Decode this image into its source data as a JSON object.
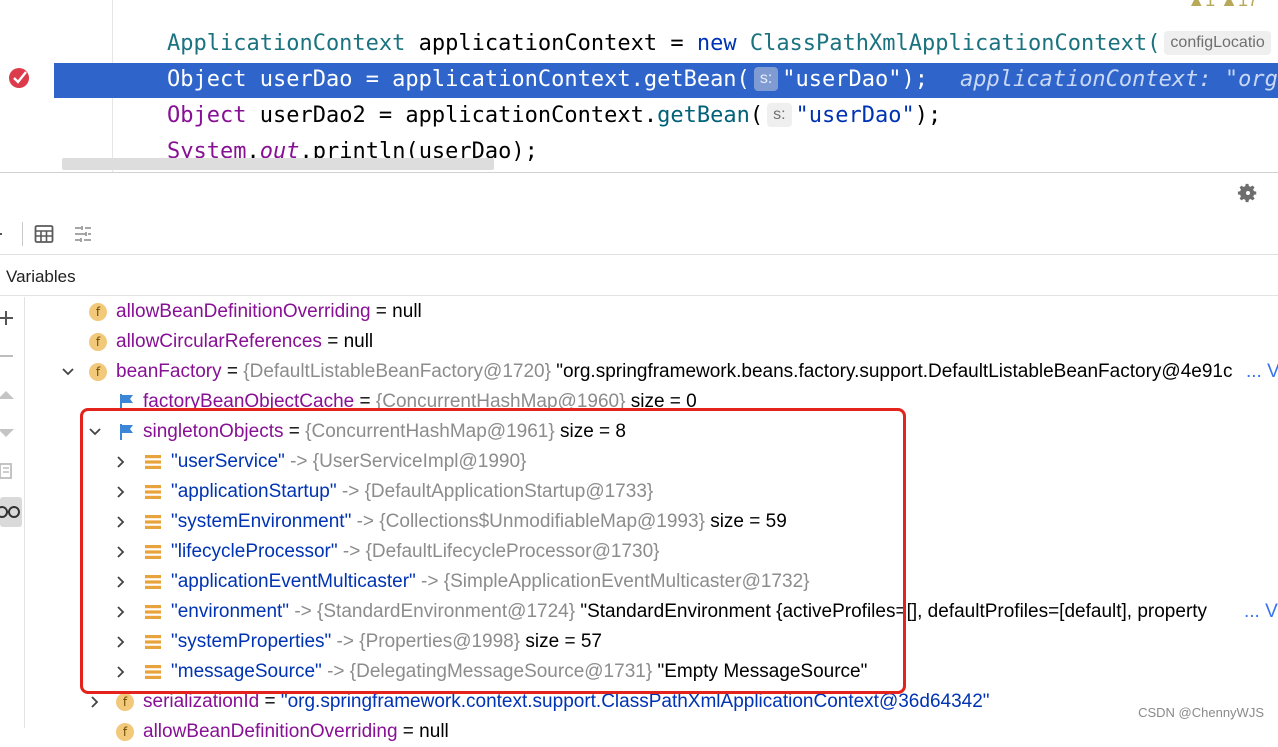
{
  "editor": {
    "line1": {
      "type": "ApplicationContext",
      "var": " applicationContext = ",
      "kw": "new",
      "cls": " ClassPathXmlApplicationContext(",
      "hint": "configLocatio"
    },
    "line2": {
      "type": "Object",
      "rest": " userDao = applicationContext.getBean(",
      "hint": "s:",
      "str": "\"userDao\"",
      "end": ");",
      "inline_hint": "applicationContext: \"org.s"
    },
    "line3": {
      "type": "Object",
      "rest": " userDao2 = applicationContext.",
      "method": "getBean",
      "paren": "(",
      "hint": "s:",
      "str": "\"userDao\"",
      "end": ");"
    },
    "line4": {
      "type": "System",
      "dot": ".",
      "field": "out",
      "rest": ".println(userDao);"
    },
    "warnings": "▲1  ▲17"
  },
  "debugger": {
    "variables_title": "Variables",
    "rows": [
      {
        "name": "allowBeanDefinitionOverriding",
        "value": " = null"
      },
      {
        "name": "allowCircularReferences",
        "value": " = null"
      },
      {
        "name": "beanFactory",
        "eq": " = ",
        "ref": "{DefaultListableBeanFactory@1720}",
        "value": " \"org.springframework.beans.factory.support.DefaultListableBeanFactory@4e91c",
        "more": "... V"
      },
      {
        "name": "factoryBeanObjectCache",
        "eq": " = ",
        "ref": "{ConcurrentHashMap@1960}",
        "value": "  size = 0"
      },
      {
        "name": "singletonObjects",
        "eq": " = ",
        "ref": "{ConcurrentHashMap@1961}",
        "value": "  size = 8"
      },
      {
        "key": "\"userService\"",
        "arrow": " -> ",
        "ref": "{UserServiceImpl@1990}",
        "value": ""
      },
      {
        "key": "\"applicationStartup\"",
        "arrow": " -> ",
        "ref": "{DefaultApplicationStartup@1733}",
        "value": ""
      },
      {
        "key": "\"systemEnvironment\"",
        "arrow": " -> ",
        "ref": "{Collections$UnmodifiableMap@1993}",
        "value": "  size = 59"
      },
      {
        "key": "\"lifecycleProcessor\"",
        "arrow": " -> ",
        "ref": "{DefaultLifecycleProcessor@1730}",
        "value": ""
      },
      {
        "key": "\"applicationEventMulticaster\"",
        "arrow": " -> ",
        "ref": "{SimpleApplicationEventMulticaster@1732}",
        "value": ""
      },
      {
        "key": "\"environment\"",
        "arrow": " -> ",
        "ref": "{StandardEnvironment@1724}",
        "value": " \"StandardEnvironment {activeProfiles=[], defaultProfiles=[default], property",
        "more": "... V"
      },
      {
        "key": "\"systemProperties\"",
        "arrow": " -> ",
        "ref": "{Properties@1998}",
        "value": "  size = 57"
      },
      {
        "key": "\"messageSource\"",
        "arrow": " -> ",
        "ref": "{DelegatingMessageSource@1731}",
        "value": " \"Empty MessageSource\""
      },
      {
        "name": "serializationId",
        "eq": " = ",
        "value": "\"org.springframework.context.support.ClassPathXmlApplicationContext@36d64342\""
      },
      {
        "name": "allowBeanDefinitionOverriding",
        "value": " = null"
      }
    ]
  },
  "watermark": "CSDN @ChennyWJS",
  "colors": {
    "execution_line": "#2f65ca",
    "highlight_box": "#e4231c",
    "field_name": "#871094",
    "string_key": "#0033b3"
  }
}
